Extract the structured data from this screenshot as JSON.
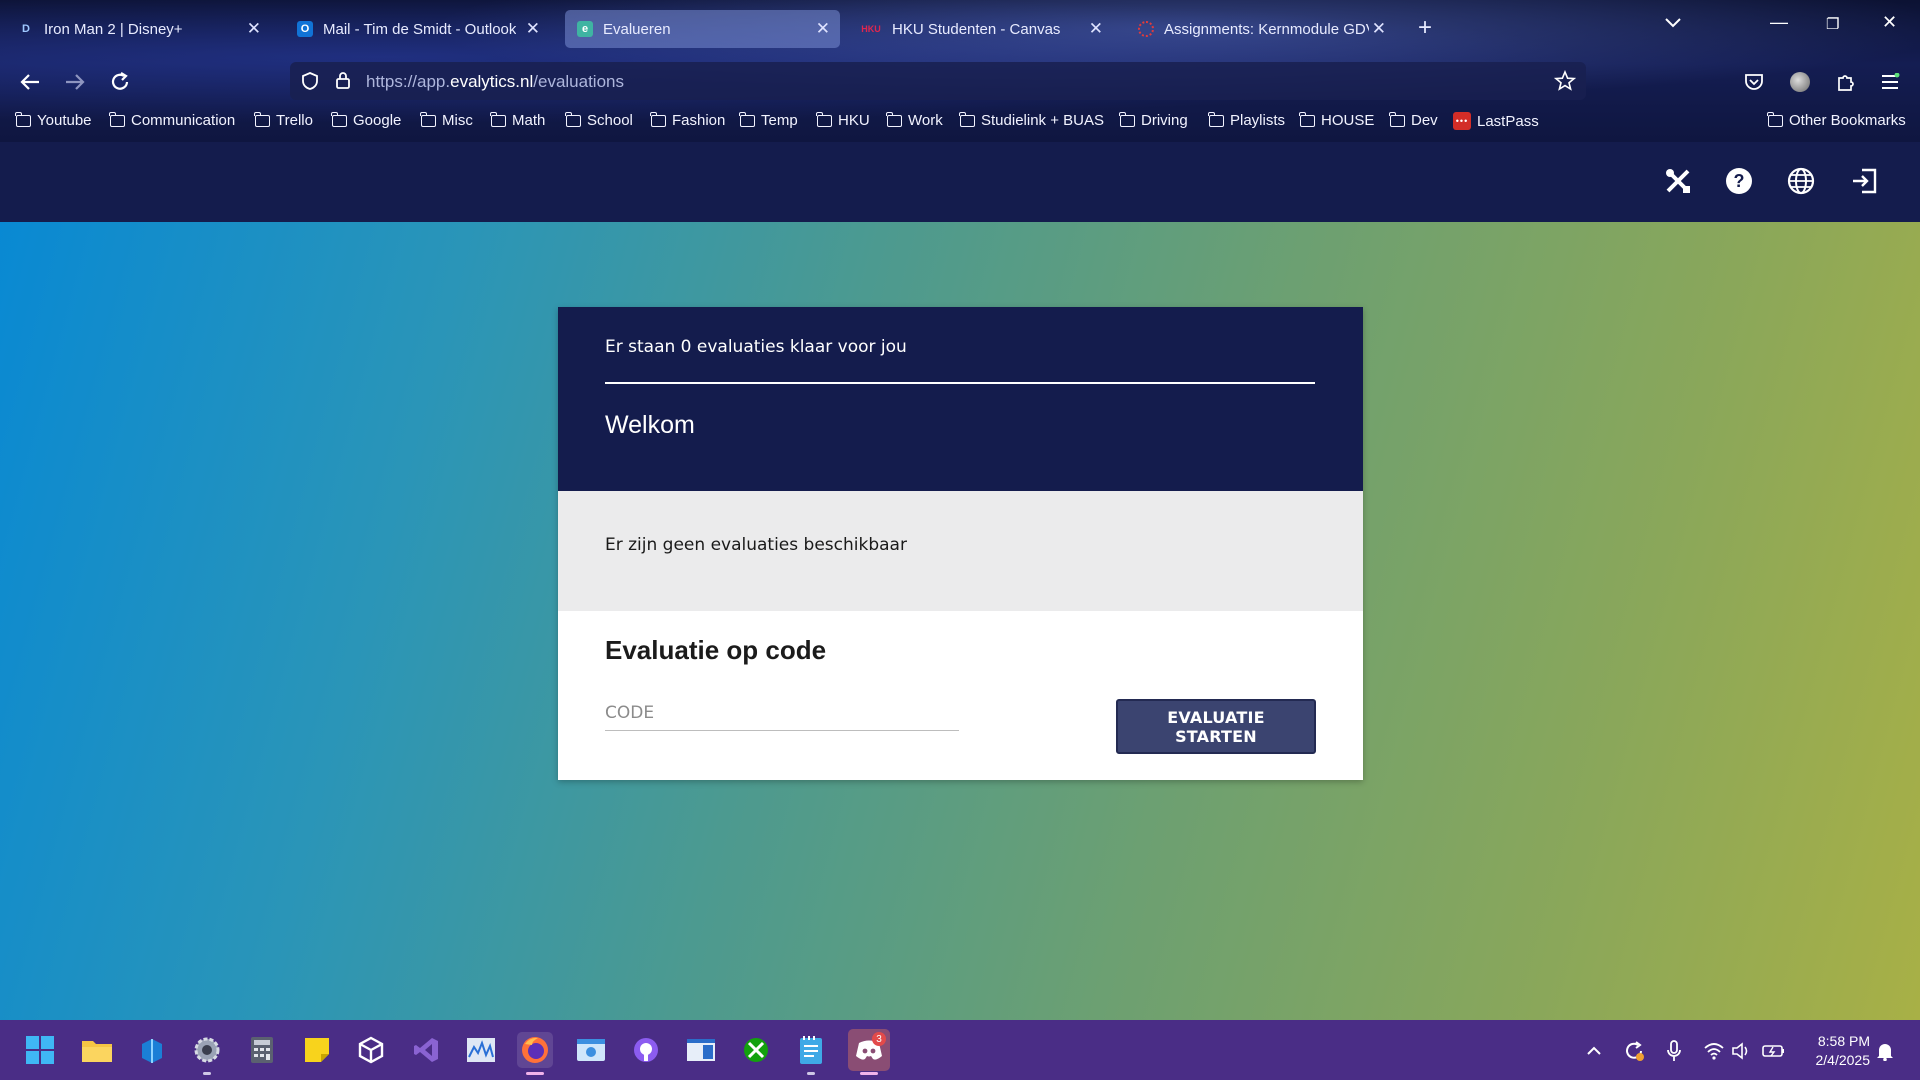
{
  "browser": {
    "tabs": [
      {
        "label": "Iron Man 2 | Disney+",
        "favicon": "disney-plus-icon"
      },
      {
        "label": "Mail - Tim de Smidt - Outlook",
        "favicon": "outlook-icon"
      },
      {
        "label": "Evalueren",
        "favicon": "evalytics-icon",
        "active": true
      },
      {
        "label": "HKU Studenten - Canvas",
        "favicon": "hku-icon"
      },
      {
        "label": "Assignments: Kernmodule GDV",
        "favicon": "canvas-icon"
      }
    ],
    "url": {
      "prefix": "https://app.",
      "domain": "evalytics.nl",
      "path": "/evaluations"
    },
    "bookmarks": [
      "Youtube",
      "Communication",
      "Trello",
      "Google",
      "Misc",
      "Math",
      "School",
      "Fashion",
      "Temp",
      "HKU",
      "Work",
      "Studielink + BUAS",
      "Driving",
      "Playlists",
      "HOUSE",
      "Dev",
      "LastPass"
    ],
    "other_bookmarks": "Other Bookmarks"
  },
  "app": {
    "header_icons": [
      "tools-icon",
      "help-icon",
      "globe-icon",
      "logout-icon"
    ],
    "card": {
      "subtitle": "Er staan 0 evaluaties klaar voor jou",
      "title": "Welkom",
      "empty_message": "Er zijn geen evaluaties beschikbaar",
      "code_section_title": "Evaluatie op code",
      "code_placeholder": "CODE",
      "code_value": "",
      "start_button": "EVALUATIE STARTEN"
    }
  },
  "taskbar": {
    "apps": [
      "start-icon",
      "file-explorer-icon",
      "ms-store-icon",
      "settings-icon",
      "calculator-icon",
      "sticky-notes-icon",
      "unity-icon",
      "visual-studio-icon",
      "activity-monitor-icon",
      "firefox-icon",
      "app-installer-icon",
      "github-icon",
      "window-icon",
      "xbox-icon",
      "notepad-icon",
      "discord-icon"
    ],
    "discord_badge": "3",
    "time": "8:58 PM",
    "date": "2/4/2025",
    "colors": {
      "bar": "#4a2d86",
      "header": "#141c4d",
      "button": "#3b4470"
    }
  }
}
